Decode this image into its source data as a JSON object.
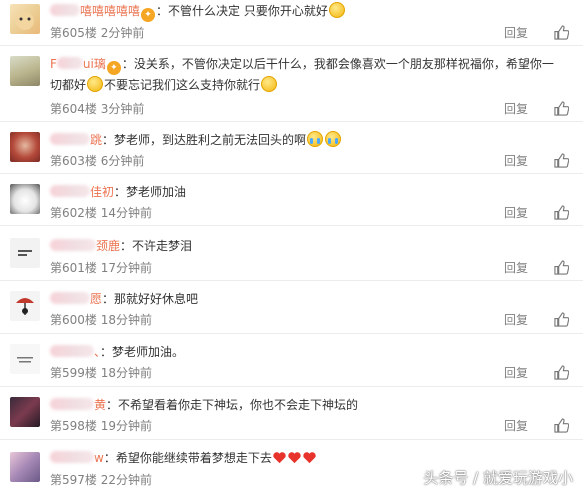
{
  "reply_label": "回复",
  "colors": {
    "username": "#eb7350",
    "meta": "#808080",
    "divider": "#ececec"
  },
  "comments": [
    {
      "username": "嘻嘻嘻嘻嘻",
      "content": "：不管什么决定 只要你开心就好",
      "emojis": [
        "smile-emoji"
      ],
      "floor": "第605楼",
      "time": "2分钟前"
    },
    {
      "username": "ui璃",
      "content": "：没关系，不管你决定以后干什么，我都会像喜欢一个朋友那样祝福你，希望你一切都好",
      "content2": "不要忘记我们这么支持你就行",
      "emojis": [
        "grin-emoji",
        "smile-emoji"
      ],
      "floor": "第604楼",
      "time": "3分钟前"
    },
    {
      "username": "跳",
      "content": "：梦老师，到达胜利之前无法回头的啊",
      "emojis": [
        "cry-emoji",
        "cry-emoji"
      ],
      "floor": "第603楼",
      "time": "6分钟前"
    },
    {
      "username": "佳初",
      "content": "：梦老师加油",
      "floor": "第602楼",
      "time": "14分钟前"
    },
    {
      "username": "颈鹿",
      "content": "：不许走梦泪",
      "floor": "第601楼",
      "time": "17分钟前"
    },
    {
      "username": "愿",
      "content": "：那就好好休息吧",
      "floor": "第600楼",
      "time": "18分钟前"
    },
    {
      "username": "、",
      "content": "：梦老师加油。",
      "floor": "第599楼",
      "time": "18分钟前"
    },
    {
      "username": "黄",
      "content": "：不希望看着你走下神坛，你也不会走下神坛的",
      "floor": "第598楼",
      "time": "19分钟前"
    },
    {
      "username": "w",
      "content": "：希望你能继续带着梦想走下去",
      "emojis": [
        "heart-emoji",
        "heart-emoji",
        "heart-emoji"
      ],
      "floor": "第597楼",
      "time": "22分钟前"
    }
  ],
  "watermark": "头条号 / 就爱玩游戏小",
  "icons": {
    "like": "thumbs-up-icon"
  }
}
